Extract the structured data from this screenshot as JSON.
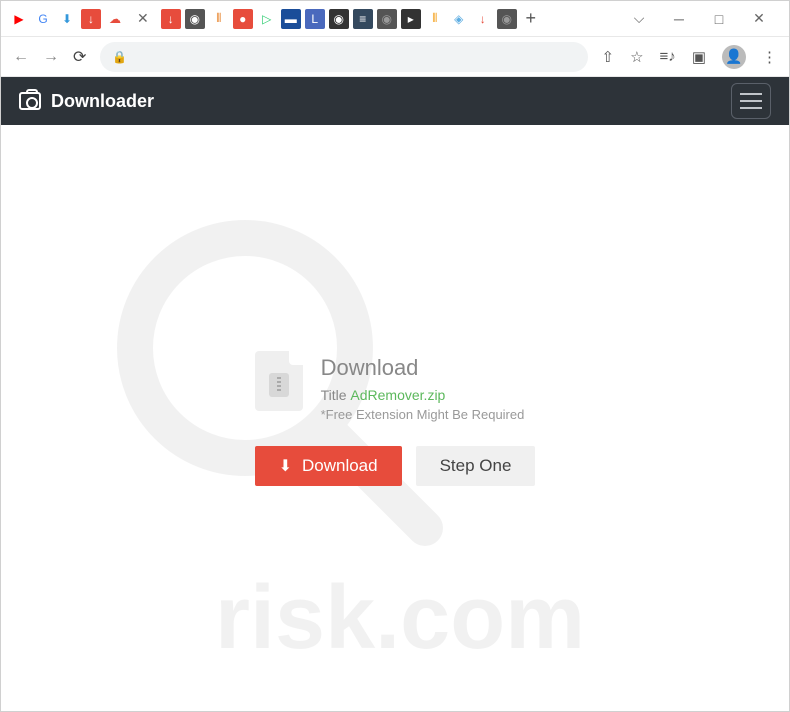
{
  "browser": {
    "favicons": [
      {
        "name": "youtube",
        "bg": "#fff",
        "content": "▶",
        "color": "#ff0000"
      },
      {
        "name": "google",
        "bg": "#fff",
        "content": "G",
        "color": "#4285f4"
      },
      {
        "name": "download1",
        "bg": "#fff",
        "content": "⬇",
        "color": "#3498db"
      },
      {
        "name": "download2",
        "bg": "#e74c3c",
        "content": "↓",
        "color": "#fff"
      },
      {
        "name": "cloud",
        "bg": "#fff",
        "content": "☁",
        "color": "#e74c3c"
      },
      {
        "name": "current",
        "bg": "#fff",
        "content": "",
        "color": "#666",
        "active": true
      },
      {
        "name": "download3",
        "bg": "#e74c3c",
        "content": "↓",
        "color": "#fff"
      },
      {
        "name": "globe1",
        "bg": "#555",
        "content": "◉",
        "color": "#fff"
      },
      {
        "name": "audio",
        "bg": "#fff",
        "content": "⫴",
        "color": "#e67e22"
      },
      {
        "name": "red1",
        "bg": "#e74c3c",
        "content": "●",
        "color": "#fff"
      },
      {
        "name": "play",
        "bg": "#fff",
        "content": "▷",
        "color": "#2ecc71"
      },
      {
        "name": "tv",
        "bg": "#1a4d99",
        "content": "▬",
        "color": "#fff"
      },
      {
        "name": "letter",
        "bg": "#4a69bd",
        "content": "L",
        "color": "#fff"
      },
      {
        "name": "record",
        "bg": "#333",
        "content": "◉",
        "color": "#fff"
      },
      {
        "name": "lines",
        "bg": "#34495e",
        "content": "≡",
        "color": "#fff"
      },
      {
        "name": "globe2",
        "bg": "#555",
        "content": "◉",
        "color": "#999"
      },
      {
        "name": "play2",
        "bg": "#333",
        "content": "▸",
        "color": "#fff"
      },
      {
        "name": "wave",
        "bg": "#fff",
        "content": "⫴",
        "color": "#f39c12"
      },
      {
        "name": "shield",
        "bg": "#fff",
        "content": "◈",
        "color": "#5dade2"
      },
      {
        "name": "download4",
        "bg": "#fff",
        "content": "↓",
        "color": "#e74c3c"
      },
      {
        "name": "globe3",
        "bg": "#555",
        "content": "◉",
        "color": "#999"
      }
    ]
  },
  "header": {
    "brand": "Downloader"
  },
  "download": {
    "heading": "Download",
    "title_label": "Title",
    "filename": "AdRemover.zip",
    "note": "*Free Extension Might Be Required",
    "download_button": "Download",
    "step_button": "Step One"
  }
}
